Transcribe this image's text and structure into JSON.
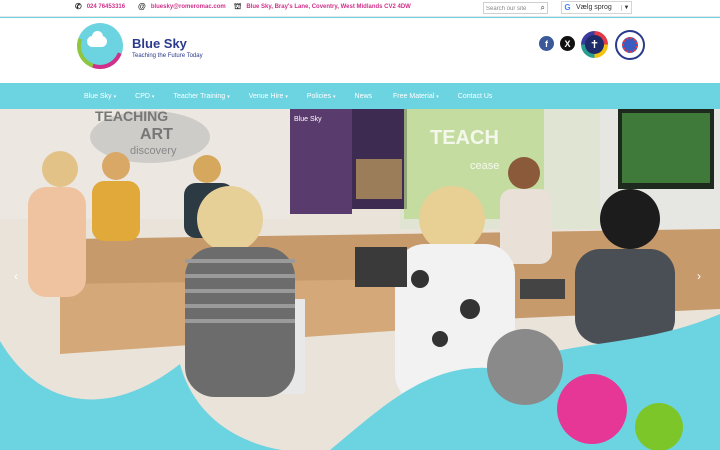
{
  "topbar": {
    "phone": "024 76453316",
    "email": "bluesky@romeromac.com",
    "address": "Blue Sky, Bray's Lane, Coventry, West Midlands CV2 4DW",
    "search_placeholder": "Search our site",
    "translate_label": "Vælg sprog"
  },
  "header": {
    "brand": "Blue Sky",
    "tagline": "Teaching the Future Today",
    "facebook_glyph": "f",
    "x_glyph": "X"
  },
  "nav": {
    "items": [
      {
        "label": "Blue Sky",
        "caret": "▾"
      },
      {
        "label": "CPD",
        "caret": "▾"
      },
      {
        "label": "Teacher Training",
        "caret": "▾"
      },
      {
        "label": "Venue Hire",
        "caret": "▾"
      },
      {
        "label": "Policies",
        "caret": "▾"
      },
      {
        "label": "News",
        "caret": ""
      },
      {
        "label": "Free Material",
        "caret": "▾"
      },
      {
        "label": "Contact Us",
        "caret": ""
      }
    ]
  },
  "hero": {
    "wall_text_1": "TEACHING",
    "wall_text_2": "ART",
    "wall_text_3": "discovery",
    "wall_text_4": "TEACH",
    "wall_text_5": "cease",
    "banner_title": "Blue Sky",
    "prev_glyph": "‹",
    "next_glyph": "›"
  },
  "colors": {
    "brand_blue": "#2a3a8c",
    "accent_cyan": "#6cd3e0",
    "accent_pink": "#d0308a",
    "accent_green": "#8ec63f",
    "accent_grey": "#888888"
  }
}
